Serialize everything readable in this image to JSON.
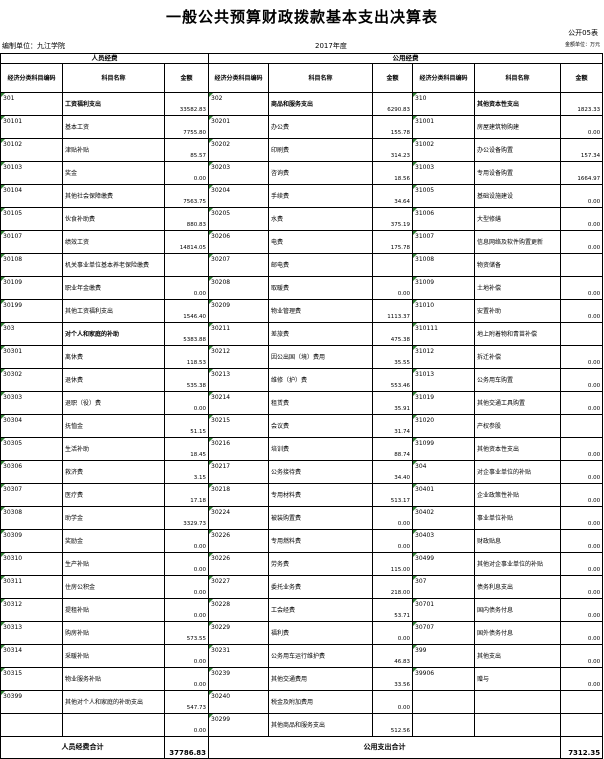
{
  "title": "一般公共预算财政拨款基本支出决算表",
  "form_no": "公开05表",
  "unit": "编制单位：九江学院",
  "year": "2017年度",
  "money_unit": "金额单位：万元",
  "groups": {
    "personnel": "人员经费",
    "public": "公用经费"
  },
  "headers": {
    "code": "经济分类科目编码",
    "name": "科目名称",
    "amount": "金额"
  },
  "rows": [
    [
      [
        "301",
        "工资福利支出",
        "33582.83",
        true
      ],
      [
        "302",
        "商品和服务支出",
        "6290.83",
        true
      ],
      [
        "310",
        "其他资本性支出",
        "1823.33",
        true
      ]
    ],
    [
      [
        "30101",
        "基本工资",
        "7755.80"
      ],
      [
        "30201",
        "办公费",
        "155.78"
      ],
      [
        "31001",
        "房屋建筑物购建",
        "0.00"
      ]
    ],
    [
      [
        "30102",
        "津贴补贴",
        "85.57"
      ],
      [
        "30202",
        "印刷费",
        "314.23"
      ],
      [
        "31002",
        "办公设备购置",
        "157.34"
      ]
    ],
    [
      [
        "30103",
        "奖金",
        "0.00"
      ],
      [
        "30203",
        "咨询费",
        "18.56"
      ],
      [
        "31003",
        "专用设备购置",
        "1664.97"
      ]
    ],
    [
      [
        "30104",
        "其他社会保障缴费",
        "7563.75"
      ],
      [
        "30204",
        "手续费",
        "34.64"
      ],
      [
        "31005",
        "基础设施建设",
        "0.00"
      ]
    ],
    [
      [
        "30105",
        "伙食补助费",
        "880.83"
      ],
      [
        "30205",
        "水费",
        "375.19"
      ],
      [
        "31006",
        "大型修缮",
        "0.00"
      ]
    ],
    [
      [
        "30107",
        "绩效工资",
        "14814.05"
      ],
      [
        "30206",
        "电费",
        "175.78"
      ],
      [
        "31007",
        "信息网络及软件购置更新",
        "0.00"
      ]
    ],
    [
      [
        "30108",
        "机关事业单位基本养老保险缴费",
        ""
      ],
      [
        "30207",
        "邮电费",
        ""
      ],
      [
        "31008",
        "物资储备",
        ""
      ]
    ],
    [
      [
        "30109",
        "职业年金缴费",
        "0.00"
      ],
      [
        "30208",
        "取暖费",
        "0.00"
      ],
      [
        "31009",
        "土地补偿",
        "0.00"
      ]
    ],
    [
      [
        "30199",
        "其他工资福利支出",
        "1546.40"
      ],
      [
        "30209",
        "物业管理费",
        "1113.37"
      ],
      [
        "31010",
        "安置补助",
        "0.00"
      ]
    ],
    [
      [
        "303",
        "对个人和家庭的补助",
        "5383.88",
        true
      ],
      [
        "30211",
        "差旅费",
        "475.38"
      ],
      [
        "310111",
        "地上附着物和青苗补偿",
        ""
      ]
    ],
    [
      [
        "30301",
        "离休费",
        "118.53"
      ],
      [
        "30212",
        "因公出国（境）费用",
        "35.55"
      ],
      [
        "31012",
        "拆迁补偿",
        "0.00"
      ]
    ],
    [
      [
        "30302",
        "退休费",
        "535.38"
      ],
      [
        "30213",
        "维修（护）费",
        "553.46"
      ],
      [
        "31013",
        "公务用车购置",
        "0.00"
      ]
    ],
    [
      [
        "30303",
        "退职（役）费",
        "0.00"
      ],
      [
        "30214",
        "租赁费",
        "35.91"
      ],
      [
        "31019",
        "其他交通工具购置",
        "0.00"
      ]
    ],
    [
      [
        "30304",
        "抚恤金",
        "51.15"
      ],
      [
        "30215",
        "会议费",
        "31.74"
      ],
      [
        "31020",
        "产权参股",
        ""
      ]
    ],
    [
      [
        "30305",
        "生活补助",
        "18.45"
      ],
      [
        "30216",
        "培训费",
        "88.74"
      ],
      [
        "31099",
        "其他资本性支出",
        "0.00"
      ]
    ],
    [
      [
        "30306",
        "救济费",
        "3.15"
      ],
      [
        "30217",
        "公务接待费",
        "34.40"
      ],
      [
        "304",
        "对企事业单位的补贴",
        "0.00"
      ]
    ],
    [
      [
        "30307",
        "医疗费",
        "17.18"
      ],
      [
        "30218",
        "专用材料费",
        "513.17"
      ],
      [
        "30401",
        "企业政策性补贴",
        "0.00"
      ]
    ],
    [
      [
        "30308",
        "助学金",
        "3329.73"
      ],
      [
        "30224",
        "被装购置费",
        "0.00"
      ],
      [
        "30402",
        "事业单位补贴",
        "0.00"
      ]
    ],
    [
      [
        "30309",
        "奖励金",
        "0.00"
      ],
      [
        "30226",
        "专用燃料费",
        "0.00"
      ],
      [
        "30403",
        "财政贴息",
        "0.00"
      ]
    ],
    [
      [
        "30310",
        "生产补贴",
        "0.00"
      ],
      [
        "30226",
        "劳务费",
        "115.00"
      ],
      [
        "30499",
        "其他对企事业单位的补贴",
        "0.00"
      ]
    ],
    [
      [
        "30311",
        "住房公积金",
        "0.00"
      ],
      [
        "30227",
        "委托业务费",
        "218.00"
      ],
      [
        "307",
        "债务利息支出",
        "0.00"
      ]
    ],
    [
      [
        "30312",
        "提租补贴",
        "0.00"
      ],
      [
        "30228",
        "工会经费",
        "53.71"
      ],
      [
        "30701",
        "国内债务付息",
        "0.00"
      ]
    ],
    [
      [
        "30313",
        "购房补贴",
        "573.55"
      ],
      [
        "30229",
        "福利费",
        "0.00"
      ],
      [
        "30707",
        "国外债务付息",
        "0.00"
      ]
    ],
    [
      [
        "30314",
        "采暖补贴",
        "0.00"
      ],
      [
        "30231",
        "公务用车运行维护费",
        "46.83"
      ],
      [
        "399",
        "其他支出",
        "0.00"
      ]
    ],
    [
      [
        "30315",
        "物业服务补贴",
        "0.00"
      ],
      [
        "30239",
        "其他交通费用",
        "33.56"
      ],
      [
        "39906",
        "赠与",
        "0.00"
      ]
    ],
    [
      [
        "30399",
        "其他对个人和家庭的补助支出",
        "547.73"
      ],
      [
        "30240",
        "税金及附加费用",
        "0.00"
      ],
      [
        "",
        "",
        " "
      ]
    ],
    [
      [
        "",
        "",
        "0.00"
      ],
      [
        "30299",
        "其他商品和服务支出",
        "512.56"
      ],
      [
        "",
        "",
        ""
      ]
    ]
  ],
  "totals": {
    "personnel_label": "人员经费合计",
    "personnel_amount": "37786.83",
    "public_label": "公用支出合计",
    "public_amount": "7312.35"
  }
}
